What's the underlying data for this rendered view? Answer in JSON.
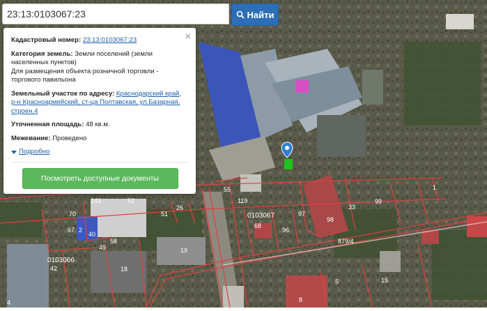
{
  "search": {
    "value": "23:13:0103067:23",
    "button_label": "Найти"
  },
  "popup": {
    "cadastral_label": "Кадастровый номер:",
    "cadastral_value": "23:13:0103067:23",
    "category_label": "Категория земель:",
    "category_value": "Земли поселений (земли населенных пунктов)",
    "usage_value": "Для размещения объекта розничной торговли - торгового павильона",
    "address_label": "Земельный участок по адресу:",
    "address_value": "Краснодарский край, р-н Красноармейский, ст-ца Полтавская, ул.Базарная, строен.4",
    "area_label": "Уточненная площадь:",
    "area_value": "48 кв.м.",
    "survey_label": "Межевание:",
    "survey_value": "Проведено",
    "more_label": "Подробно",
    "docs_button": "Посмотреть доступные документы",
    "close_symbol": "×"
  },
  "map": {
    "block_labels": [
      "0103067",
      "0103066"
    ],
    "road_label": "879/4",
    "parcels": [
      "55",
      "119",
      "143",
      "52",
      "97",
      "98",
      "33",
      "99",
      "40",
      "1",
      "2",
      "70",
      "67",
      "49",
      "58",
      "51",
      "26",
      "19",
      "18",
      "42",
      "5",
      "8",
      "68",
      "96",
      "15",
      "4"
    ],
    "marker_color": "#2f7fd6",
    "highlight_color": "#1ec31e",
    "boundary_color": "#e04040"
  }
}
